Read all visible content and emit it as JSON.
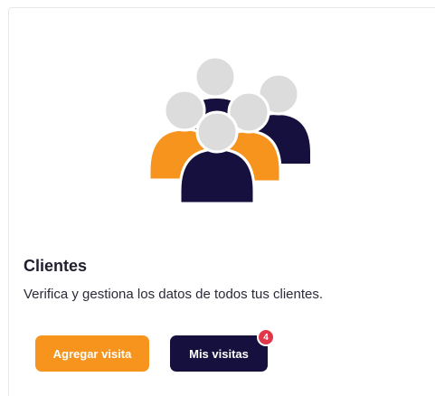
{
  "card": {
    "icon": "people-group-icon",
    "title": "Clientes",
    "description": "Verifica y gestiona los datos de todos tus clientes.",
    "primary_button_label": "Agregar visita",
    "secondary_button_label": "Mis visitas",
    "notification_count": "4"
  },
  "colors": {
    "accent_orange": "#f7941d",
    "brand_navy": "#15103d",
    "head_gray": "#dcdcdc",
    "badge_red": "#e0374a"
  }
}
